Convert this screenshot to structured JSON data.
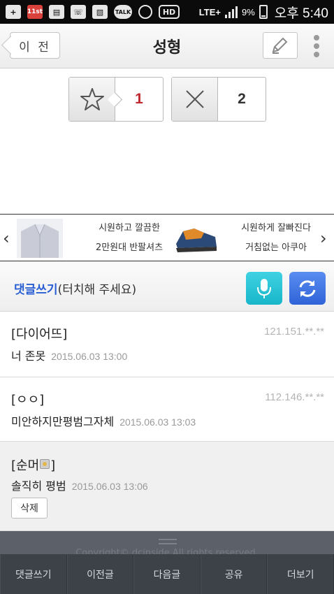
{
  "status_bar": {
    "icons": [
      "plus-icon",
      "11st-app-icon",
      "gallery-app-icon",
      "phone-icon",
      "image-icon",
      "talk-icon",
      "alarm-icon",
      "hd-voice-icon"
    ],
    "icon_texts": {
      "app": "11st",
      "talk": "TALK",
      "hd": "HD"
    },
    "network": "LTE+",
    "battery": "9%",
    "time": "오후 5:40"
  },
  "header": {
    "back_label": "이 전",
    "title": "성형"
  },
  "votes": {
    "recommend_count": "1",
    "not_recommend_count": "2"
  },
  "ad": {
    "item1_line1": "시원하고 깔끔한",
    "item1_line2": "2만원대 반팔셔츠",
    "item2_line1": "시원하게 잘빠진다",
    "item2_line2": "거침없는 아쿠아",
    "prev_arrow": "‹",
    "next_arrow": "›"
  },
  "comment_bar": {
    "label_bold": "댓글쓰기",
    "label_hint": "(터치해 주세요)"
  },
  "comments": [
    {
      "author": "[다이어뜨]",
      "ip": "121.151.**.**",
      "text": "너 존못",
      "date": "2015.06.03 13:00"
    },
    {
      "author": "[ㅇㅇ]",
      "ip": "112.146.**.**",
      "text": "미안하지만평범그자체",
      "date": "2015.06.03 13:03"
    },
    {
      "author_prefix": "[순머",
      "author_suffix": "]",
      "text": "솔직히 평범",
      "date": "2015.06.03 13:06",
      "delete_label": "삭제"
    }
  ],
  "footer": {
    "copyright": "Copyright© dcinside All rights reserved."
  },
  "bottom_nav": [
    "댓글쓰기",
    "이전글",
    "다음글",
    "공유",
    "더보기"
  ],
  "colors": {
    "accent_blue": "#2a5fd4",
    "recommend_red": "#c0282e",
    "mic_cyan": "#18b6c9",
    "refresh_blue": "#2f63d8",
    "bottom_bar": "#3d4249"
  }
}
